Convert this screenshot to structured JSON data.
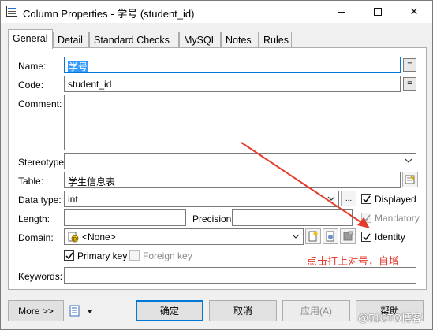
{
  "window": {
    "title": "Column Properties - 学号 (student_id)",
    "controls": {
      "minimize": "minimize",
      "maximize": "maximize",
      "close": "✕"
    }
  },
  "tabs": [
    {
      "label": "General",
      "active": true
    },
    {
      "label": "Detail"
    },
    {
      "label": "Standard Checks"
    },
    {
      "label": "MySQL"
    },
    {
      "label": "Notes"
    },
    {
      "label": "Rules"
    }
  ],
  "form": {
    "name": {
      "label": "Name:",
      "value": "学号",
      "button": "="
    },
    "code": {
      "label": "Code:",
      "value": "student_id",
      "button": "="
    },
    "comment": {
      "label": "Comment:",
      "value": ""
    },
    "stereotype": {
      "label": "Stereotype:",
      "value": ""
    },
    "table": {
      "label": "Table:",
      "value": "学生信息表"
    },
    "data_type": {
      "label": "Data type:",
      "value": "int",
      "ellipsis": "..."
    },
    "length": {
      "label": "Length:",
      "value": ""
    },
    "precision": {
      "label": "Precision:",
      "value": ""
    },
    "domain": {
      "label": "Domain:",
      "value": "<None>"
    },
    "keywords": {
      "label": "Keywords:",
      "value": ""
    }
  },
  "checkboxes": {
    "displayed": {
      "label": "Displayed",
      "checked": true,
      "enabled": true
    },
    "mandatory": {
      "label": "Mandatory",
      "checked": true,
      "enabled": false
    },
    "identity": {
      "label": "Identity",
      "checked": true,
      "enabled": true
    },
    "primary_key": {
      "label": "Primary key",
      "checked": true,
      "enabled": true
    },
    "foreign_key": {
      "label": "Foreign key",
      "checked": false,
      "enabled": false
    }
  },
  "buttons": {
    "more": "More >>",
    "ok": "确定",
    "cancel": "取消",
    "apply": "应用(A)",
    "help": "帮助"
  },
  "annotation": {
    "text": "点击打上对号，自增",
    "color": "#e53b2c"
  },
  "watermark": "@51CTO博客",
  "colors": {
    "accent": "#0078d7",
    "selection": "#3399ff"
  }
}
